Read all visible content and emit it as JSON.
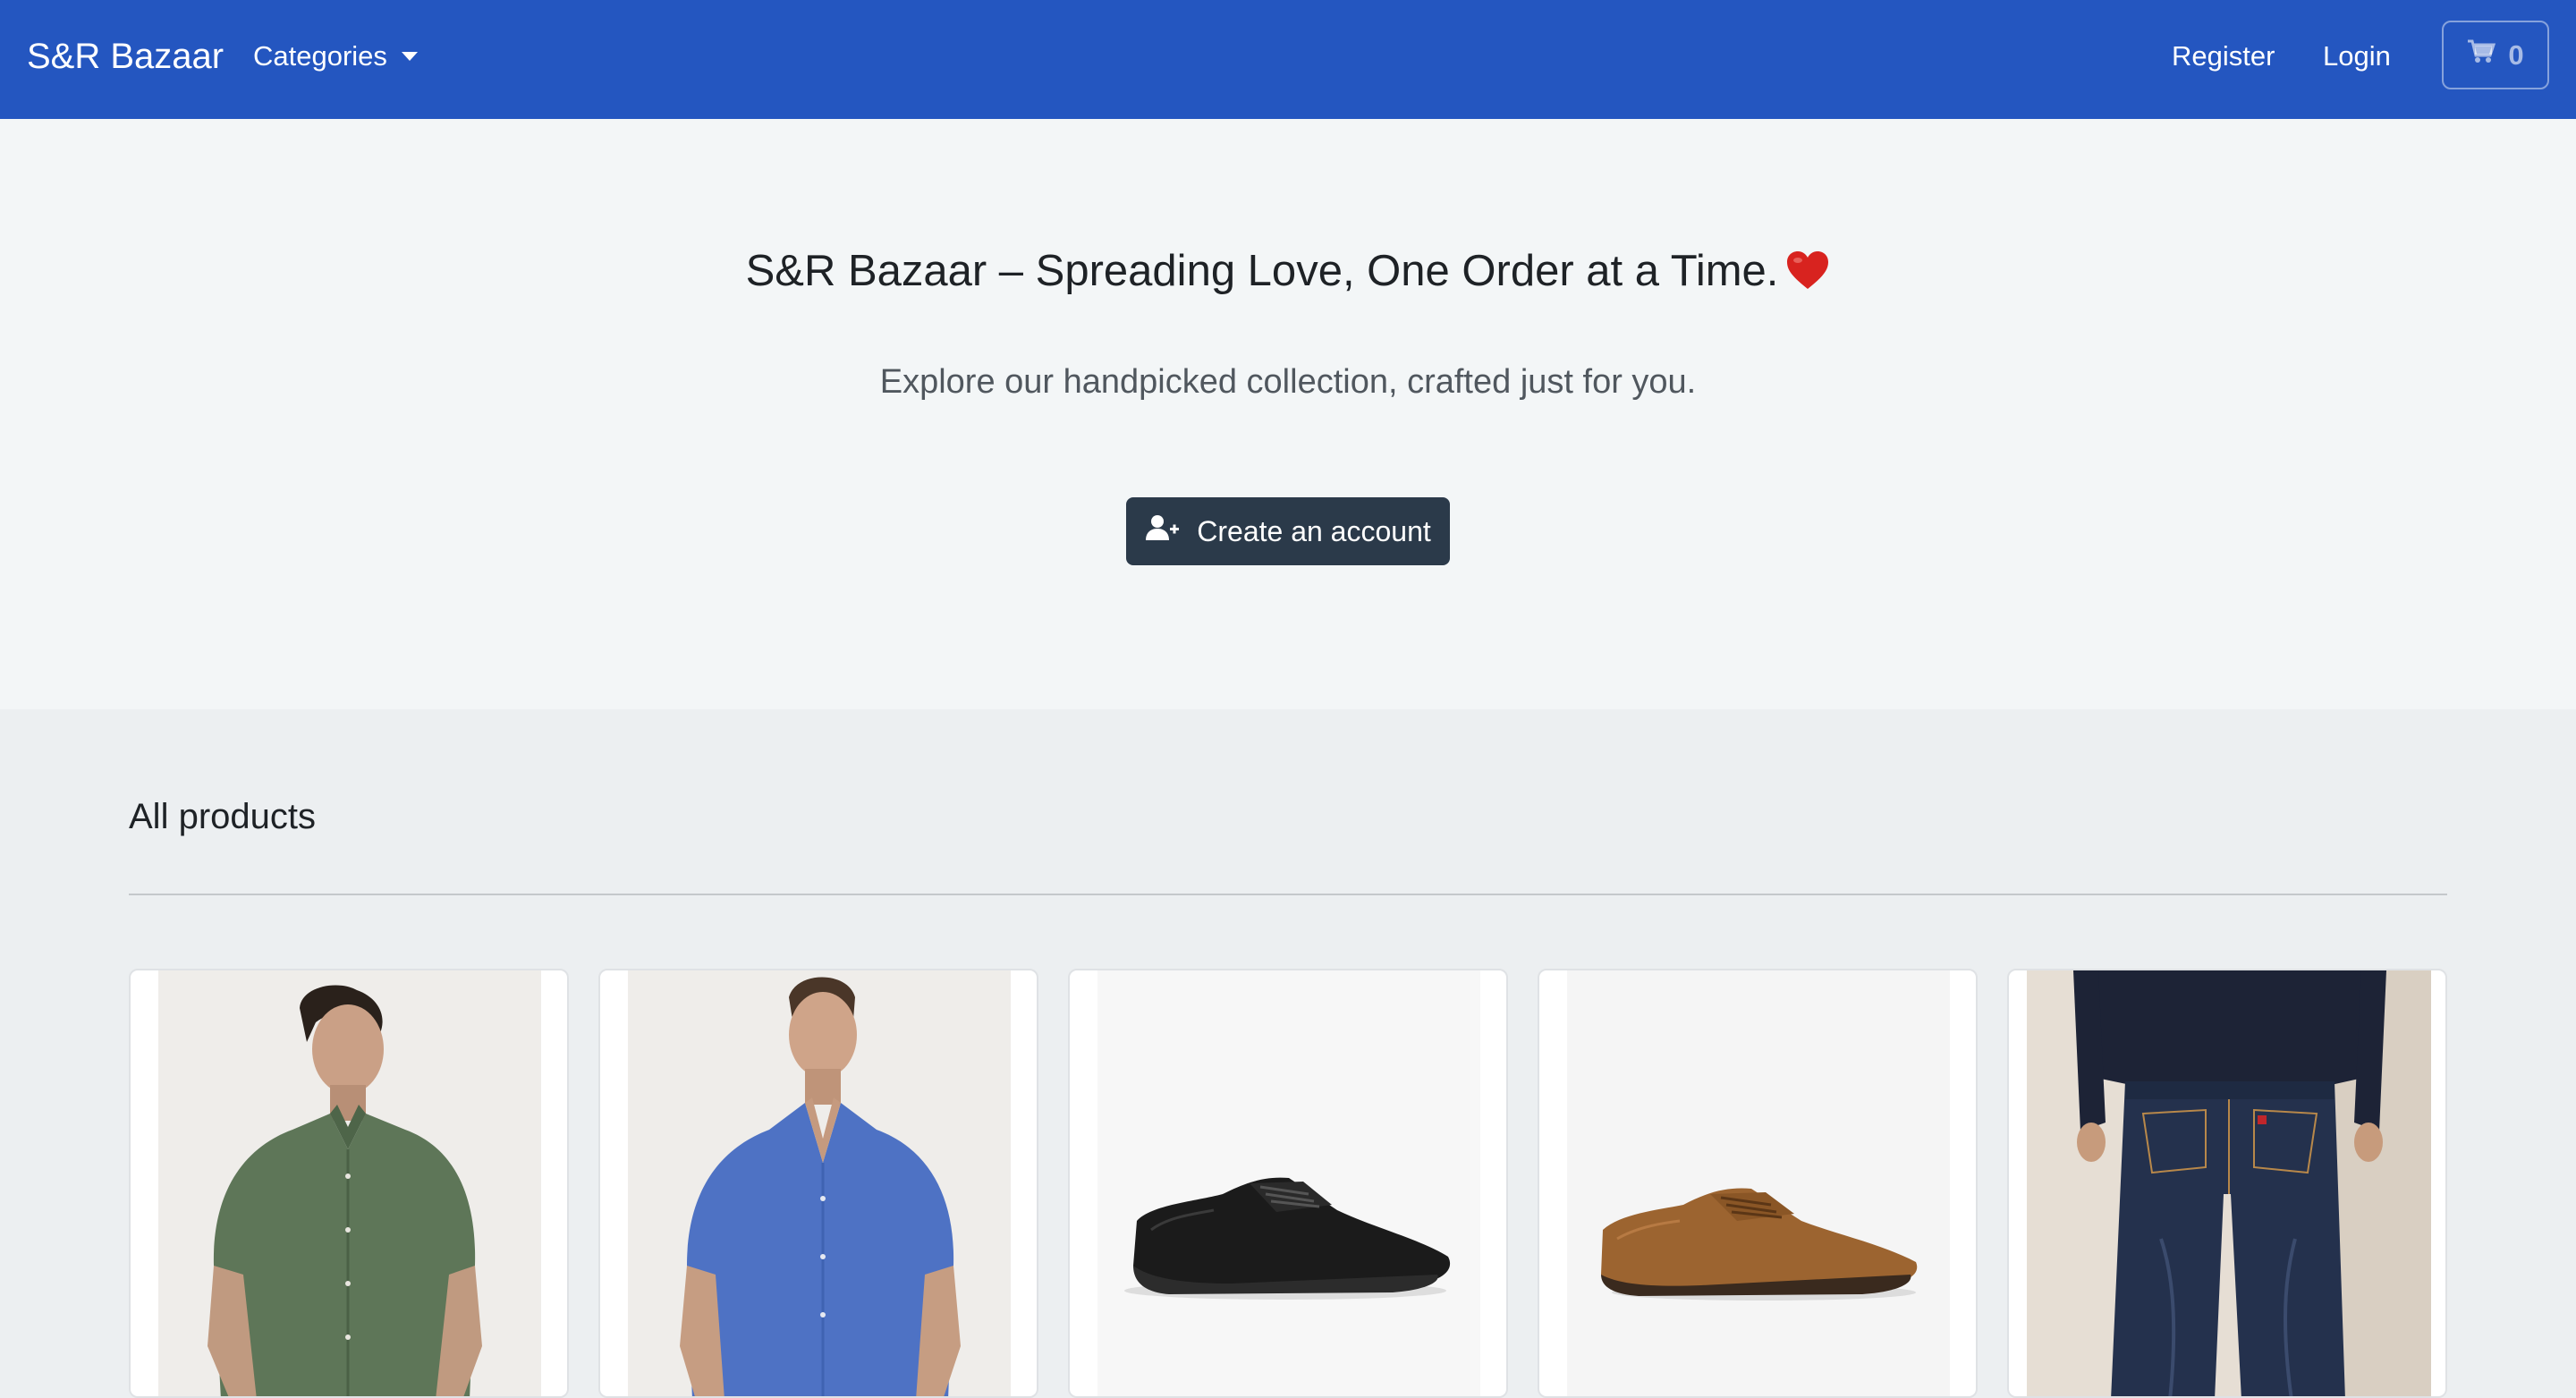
{
  "navbar": {
    "brand": "S&R Bazaar",
    "categories_label": "Categories",
    "register_label": "Register",
    "login_label": "Login",
    "cart_count": "0",
    "cart_icon": "cart-icon",
    "bg_color": "#2456c0"
  },
  "hero": {
    "title": "S&R Bazaar – Spreading Love, One Order at a Time.",
    "title_emoji": "heart-emoji",
    "subtitle": "Explore our handpicked collection, crafted just for you.",
    "cta_label": "Create an account",
    "cta_icon": "user-plus-icon"
  },
  "products": {
    "section_title": "All products",
    "items": [
      {
        "image": "man-green-shirt"
      },
      {
        "image": "man-blue-shirt"
      },
      {
        "image": "black-derby-shoe"
      },
      {
        "image": "brown-derby-shoe"
      },
      {
        "image": "man-dark-jeans"
      }
    ]
  }
}
